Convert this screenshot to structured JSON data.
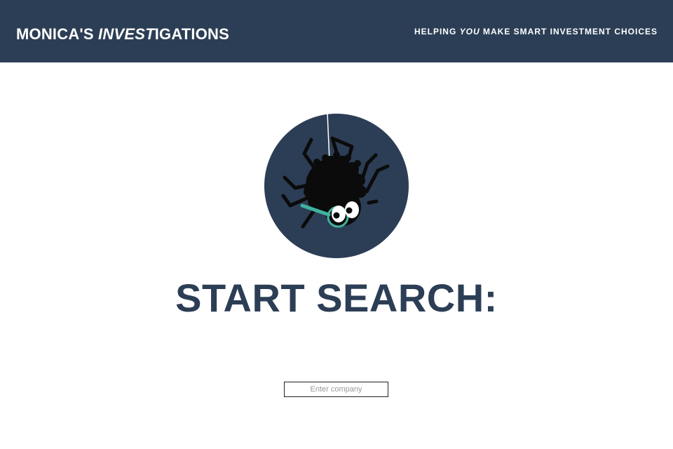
{
  "header": {
    "brand_part1": "MONICA'S ",
    "brand_emph": "INVEST",
    "brand_part2": "IGATIONS",
    "tagline_part1": "HELPING ",
    "tagline_emph": "YOU",
    "tagline_part2": " MAKE SMART INVESTMENT CHOICES"
  },
  "logo": {
    "icon": "spider-with-magnifying-glass-icon",
    "background_color": "#2c3e55",
    "accent_color": "#3fb3a0"
  },
  "main": {
    "title": "START SEARCH:"
  },
  "search": {
    "placeholder": "Enter company",
    "value": ""
  }
}
